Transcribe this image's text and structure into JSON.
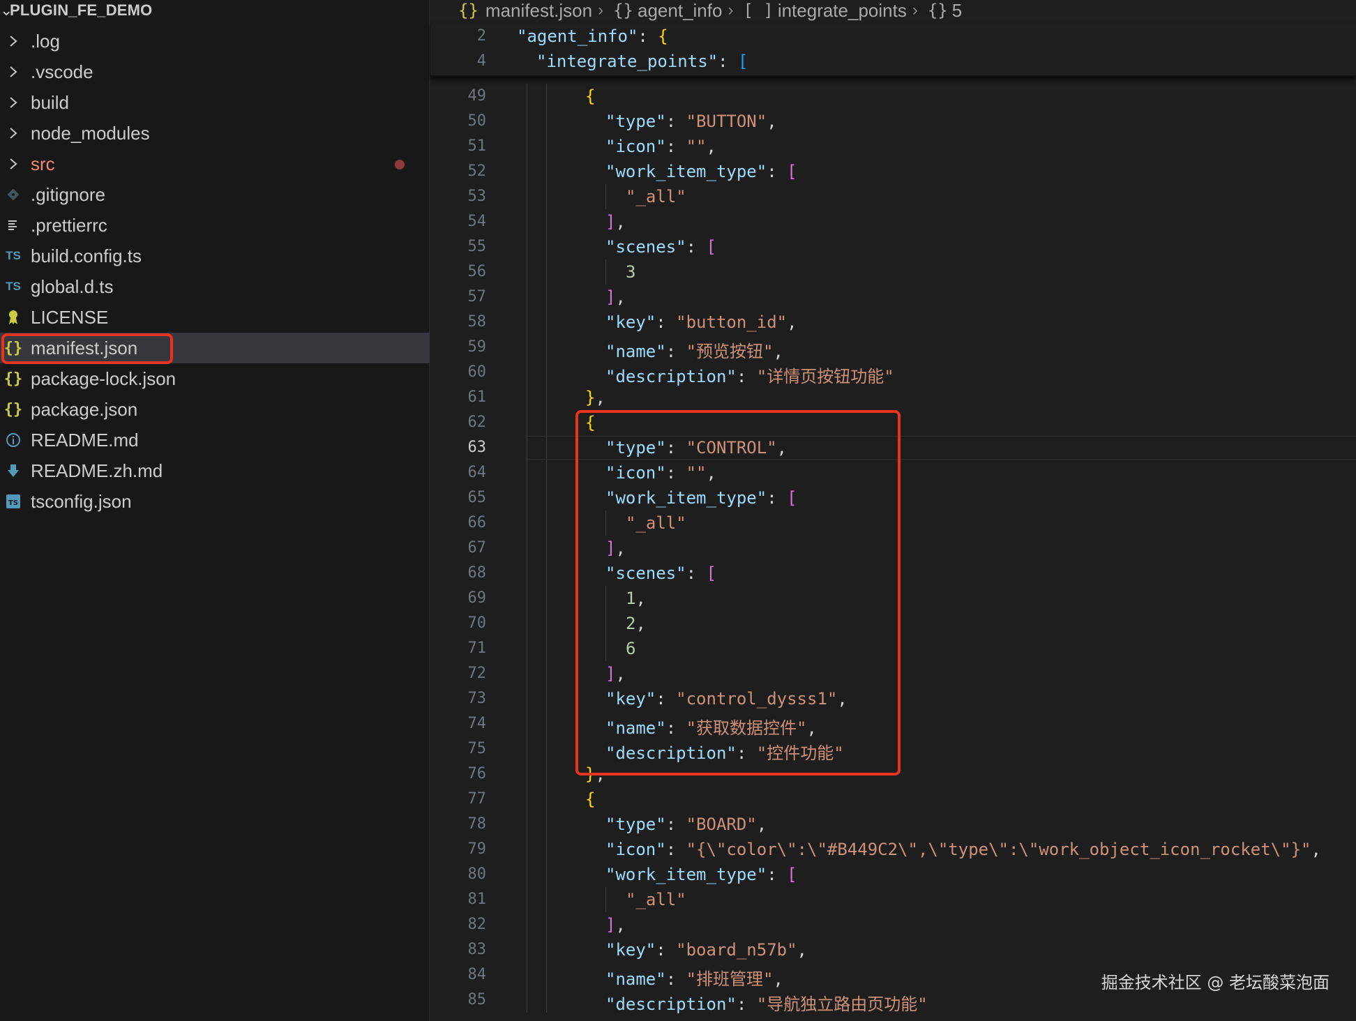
{
  "explorer": {
    "project": "PLUGIN_FE_DEMO",
    "items": [
      {
        "label": ".log",
        "icon": "chevron-right-icon"
      },
      {
        "label": ".vscode",
        "icon": "chevron-right-icon"
      },
      {
        "label": "build",
        "icon": "chevron-right-icon"
      },
      {
        "label": "node_modules",
        "icon": "chevron-right-icon"
      },
      {
        "label": "src",
        "icon": "chevron-right-icon"
      },
      {
        "label": ".gitignore",
        "icon": "git-icon"
      },
      {
        "label": ".prettierrc",
        "icon": "lines-icon"
      },
      {
        "label": "build.config.ts",
        "icon": "typescript-icon",
        "icon_text": "TS"
      },
      {
        "label": "global.d.ts",
        "icon": "typescript-icon",
        "icon_text": "TS"
      },
      {
        "label": "LICENSE",
        "icon": "certificate-icon"
      },
      {
        "label": "manifest.json",
        "icon": "json-icon",
        "icon_text": "{}"
      },
      {
        "label": "package-lock.json",
        "icon": "json-icon",
        "icon_text": "{}"
      },
      {
        "label": "package.json",
        "icon": "json-icon",
        "icon_text": "{}"
      },
      {
        "label": "README.md",
        "icon": "info-icon"
      },
      {
        "label": "README.zh.md",
        "icon": "download-icon"
      },
      {
        "label": "tsconfig.json",
        "icon": "ts-config-icon",
        "icon_text": "TS"
      }
    ],
    "selected": "manifest.json",
    "modified": "src"
  },
  "breadcrumb": {
    "file": "manifest.json",
    "file_icon": "{}",
    "parts": [
      {
        "symbol": "{}",
        "label": "agent_info"
      },
      {
        "symbol": "[ ]",
        "label": "integrate_points"
      },
      {
        "symbol": "{}",
        "label": "5"
      }
    ]
  },
  "sticky_lines": [
    {
      "num": "2",
      "key": "\"agent_info\"",
      "open": "{"
    },
    {
      "num": "4",
      "key": "\"integrate_points\"",
      "open": "["
    }
  ],
  "code_lines": [
    {
      "num": "49",
      "text": "{"
    },
    {
      "num": "50",
      "text": "\"type\": \"BUTTON\","
    },
    {
      "num": "51",
      "text": "\"icon\": \"\","
    },
    {
      "num": "52",
      "text": "\"work_item_type\": ["
    },
    {
      "num": "53",
      "text": "\"_all\""
    },
    {
      "num": "54",
      "text": "],"
    },
    {
      "num": "55",
      "text": "\"scenes\": ["
    },
    {
      "num": "56",
      "text": "3"
    },
    {
      "num": "57",
      "text": "],"
    },
    {
      "num": "58",
      "text": "\"key\": \"button_id\","
    },
    {
      "num": "59",
      "text": "\"name\": \"预览按钮\","
    },
    {
      "num": "60",
      "text": "\"description\": \"详情页按钮功能\""
    },
    {
      "num": "61",
      "text": "},"
    },
    {
      "num": "62",
      "text": "{"
    },
    {
      "num": "63",
      "text": "\"type\": \"CONTROL\","
    },
    {
      "num": "64",
      "text": "\"icon\": \"\","
    },
    {
      "num": "65",
      "text": "\"work_item_type\": ["
    },
    {
      "num": "66",
      "text": "\"_all\""
    },
    {
      "num": "67",
      "text": "],"
    },
    {
      "num": "68",
      "text": "\"scenes\": ["
    },
    {
      "num": "69",
      "text": "1,"
    },
    {
      "num": "70",
      "text": "2,"
    },
    {
      "num": "71",
      "text": "6"
    },
    {
      "num": "72",
      "text": "],"
    },
    {
      "num": "73",
      "text": "\"key\": \"control_dysss1\","
    },
    {
      "num": "74",
      "text": "\"name\": \"获取数据控件\","
    },
    {
      "num": "75",
      "text": "\"description\": \"控件功能\""
    },
    {
      "num": "76",
      "text": "},"
    },
    {
      "num": "77",
      "text": "{"
    },
    {
      "num": "78",
      "text": "\"type\": \"BOARD\","
    },
    {
      "num": "79",
      "text": "\"icon\": \"{\\\"color\\\":\\\"#B449C2\\\",\\\"type\\\":\\\"work_object_icon_rocket\\\"}\","
    },
    {
      "num": "80",
      "text": "\"work_item_type\": ["
    },
    {
      "num": "81",
      "text": "\"_all\""
    },
    {
      "num": "82",
      "text": "],"
    },
    {
      "num": "83",
      "text": "\"key\": \"board_n57b\","
    },
    {
      "num": "84",
      "text": "\"name\": \"排班管理\","
    },
    {
      "num": "85",
      "text": "\"description\": \"导航独立路由页功能\""
    }
  ],
  "active_line": "63",
  "watermark": "掘金技术社区 @ 老坛酸菜泡面",
  "colors": {
    "key": "#9cdcfe",
    "string": "#ce9178",
    "number": "#b5cea8",
    "bracket_level1": "#ffd700",
    "bracket_level2": "#da70d6",
    "highlight_box": "#e8331f"
  }
}
